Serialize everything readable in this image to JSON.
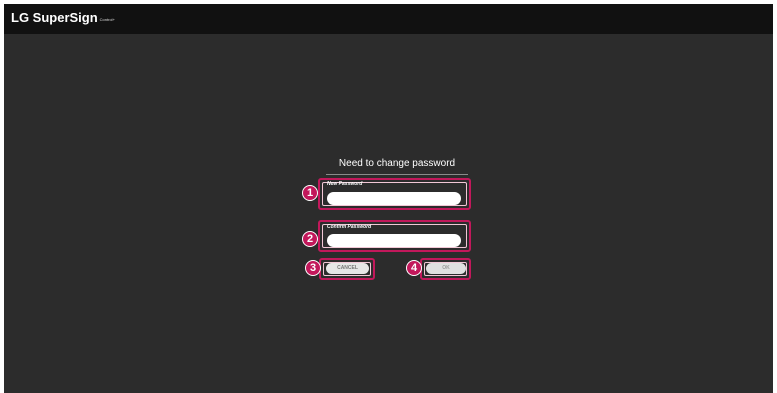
{
  "app": {
    "brand": "LG SuperSign",
    "brand_suffix": "Control+"
  },
  "dialog": {
    "title": "Need to change password",
    "new_password_label": "New Password",
    "new_password_value": "",
    "confirm_password_label": "Confirm Password",
    "confirm_password_value": "",
    "cancel_label": "CANCEL",
    "ok_label": "OK"
  },
  "callouts": [
    "1",
    "2",
    "3",
    "4"
  ],
  "colors": {
    "highlight": "#c2185b",
    "background": "#2c2c2c",
    "topbar": "#111111"
  }
}
